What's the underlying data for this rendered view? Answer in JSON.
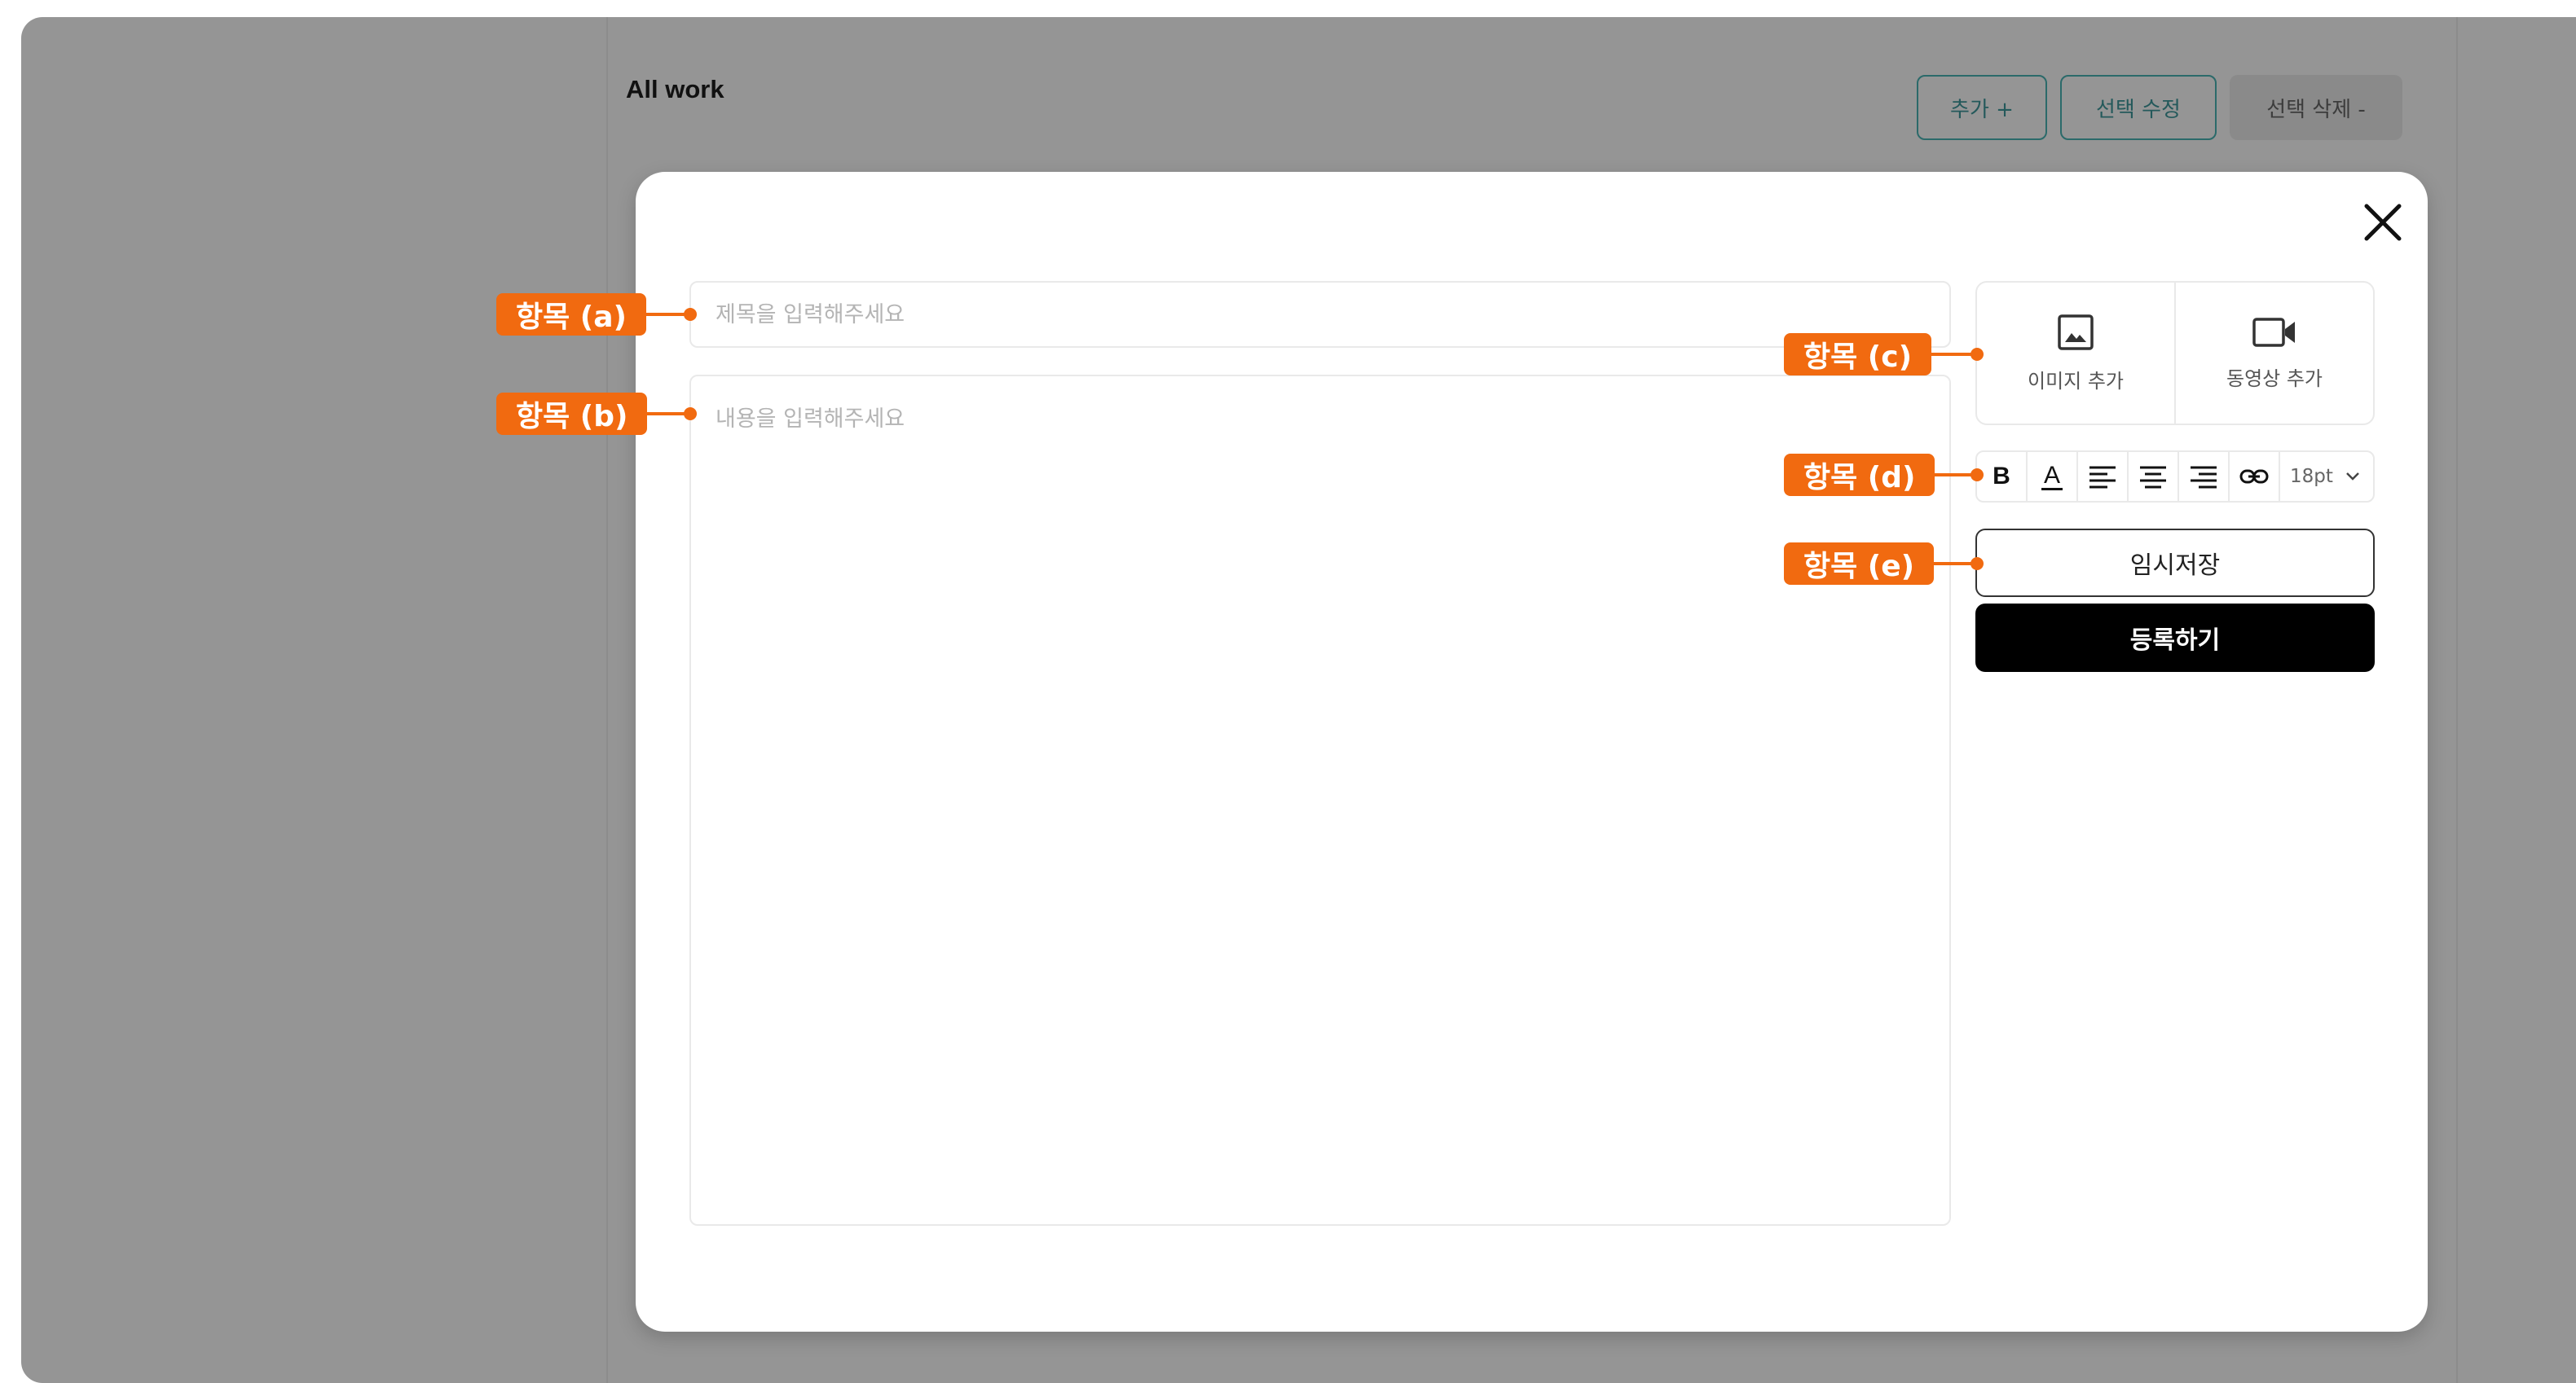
{
  "background": {
    "section_title": "All work",
    "buttons": {
      "add": "추가 +",
      "edit": "선택 수정",
      "delete": "선택 삭제 -"
    }
  },
  "modal": {
    "title_placeholder": "제목을 입력해주세요",
    "content_placeholder": "내용을 입력해주세요",
    "media": {
      "image_label": "이미지 추가",
      "video_label": "동영상 추가"
    },
    "toolbar": {
      "bold": "B",
      "font_color": "A",
      "font_size": "18pt"
    },
    "draft_button": "임시저장",
    "submit_button": "등록하기"
  },
  "callouts": {
    "a": "항목 (a)",
    "b": "항목 (b)",
    "c": "항목 (c)",
    "d": "항목 (d)",
    "e": "항목 (e)"
  },
  "colors": {
    "overlay": "#959595",
    "callout": "#f16a10",
    "accent_teal": "#2b6a6a",
    "primary_button": "#000000"
  }
}
